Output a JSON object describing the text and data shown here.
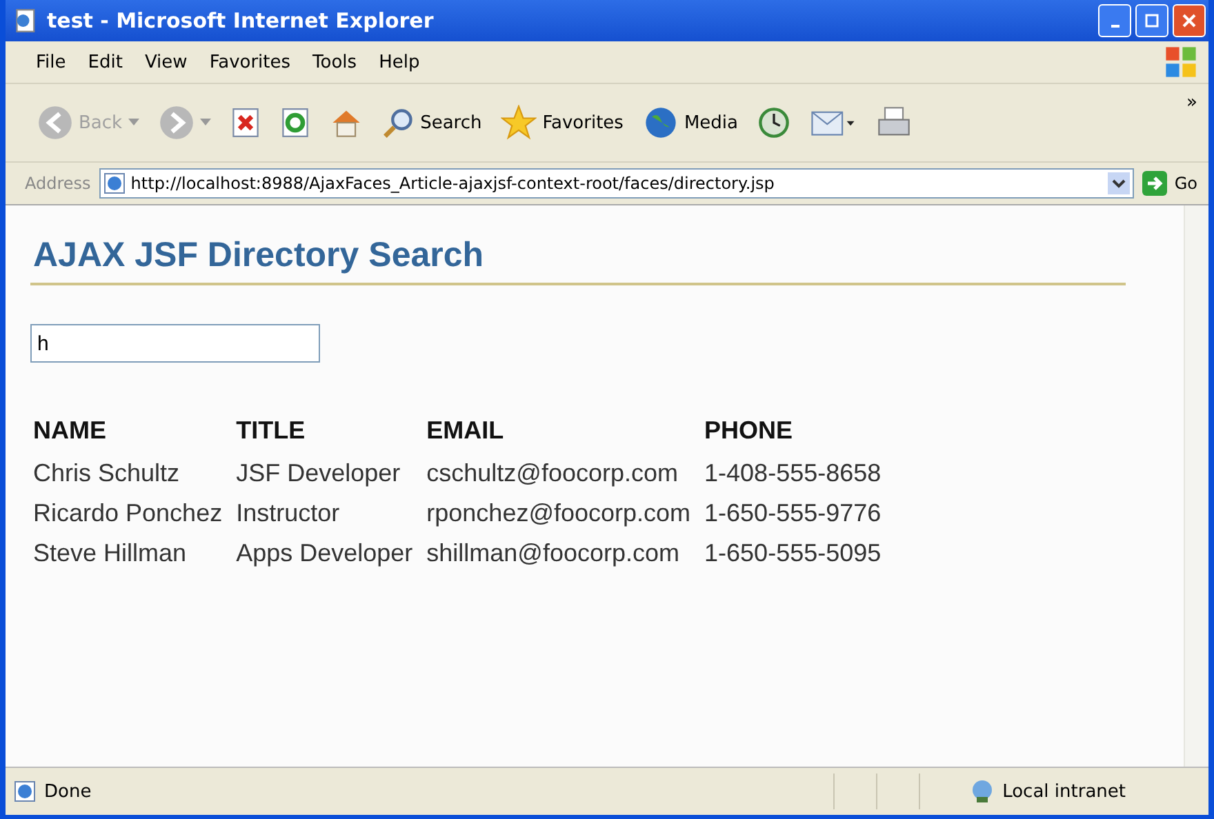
{
  "window": {
    "title": "test - Microsoft Internet Explorer"
  },
  "menu": [
    "File",
    "Edit",
    "View",
    "Favorites",
    "Tools",
    "Help"
  ],
  "toolbar": [
    {
      "kind": "back",
      "label": "Back",
      "disabled": true
    },
    {
      "kind": "forward",
      "disabled": true
    },
    {
      "kind": "stop"
    },
    {
      "kind": "refresh"
    },
    {
      "kind": "home"
    },
    {
      "kind": "search",
      "label": "Search"
    },
    {
      "kind": "favorites",
      "label": "Favorites"
    },
    {
      "kind": "media",
      "label": "Media"
    },
    {
      "kind": "history"
    },
    {
      "kind": "mail"
    },
    {
      "kind": "print"
    }
  ],
  "toolbar_more": "»",
  "address": {
    "label": "Address",
    "value": "http://localhost:8988/AjaxFaces_Article-ajaxjsf-context-root/faces/directory.jsp",
    "go": "Go"
  },
  "page": {
    "heading": "AJAX JSF Directory Search",
    "search_value": "h",
    "table": {
      "columns": [
        "NAME",
        "TITLE",
        "EMAIL",
        "PHONE"
      ],
      "rows": [
        [
          "Chris Schultz",
          "JSF Developer",
          "cschultz@foocorp.com",
          "1-408-555-8658"
        ],
        [
          "Ricardo Ponchez",
          "Instructor",
          "rponchez@foocorp.com",
          "1-650-555-9776"
        ],
        [
          "Steve Hillman",
          "Apps Developer",
          "shillman@foocorp.com",
          "1-650-555-5095"
        ]
      ]
    }
  },
  "status_bar": {
    "text": "Done",
    "zone": "Local intranet"
  }
}
